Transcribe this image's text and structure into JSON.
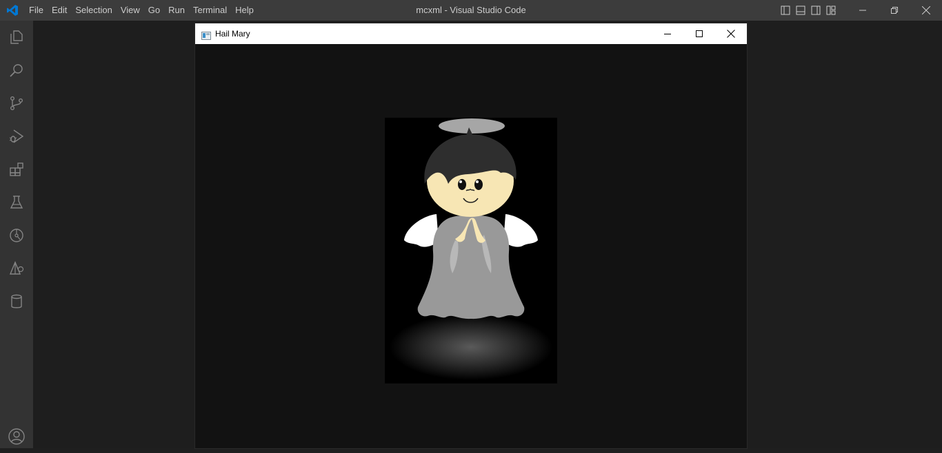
{
  "vscode": {
    "menu": [
      "File",
      "Edit",
      "Selection",
      "View",
      "Go",
      "Run",
      "Terminal",
      "Help"
    ],
    "window_title": "mcxml - Visual Studio Code",
    "accent": "#0078d4",
    "activity_bar": [
      "explorer-icon",
      "search-icon",
      "source-control-icon",
      "run-debug-icon",
      "extensions-icon",
      "testing-icon",
      "timeline-icon",
      "remote-icon",
      "database-icon",
      "account-icon"
    ]
  },
  "app": {
    "title": "Hail Mary",
    "controls": [
      "minimize-icon",
      "maximize-icon",
      "close-icon"
    ],
    "canvas_background": "#000000",
    "robe_color": "#999999",
    "skin_color": "#f7e6b4",
    "hair_color": "#2e2e2e",
    "wing_color": "#ffffff"
  }
}
